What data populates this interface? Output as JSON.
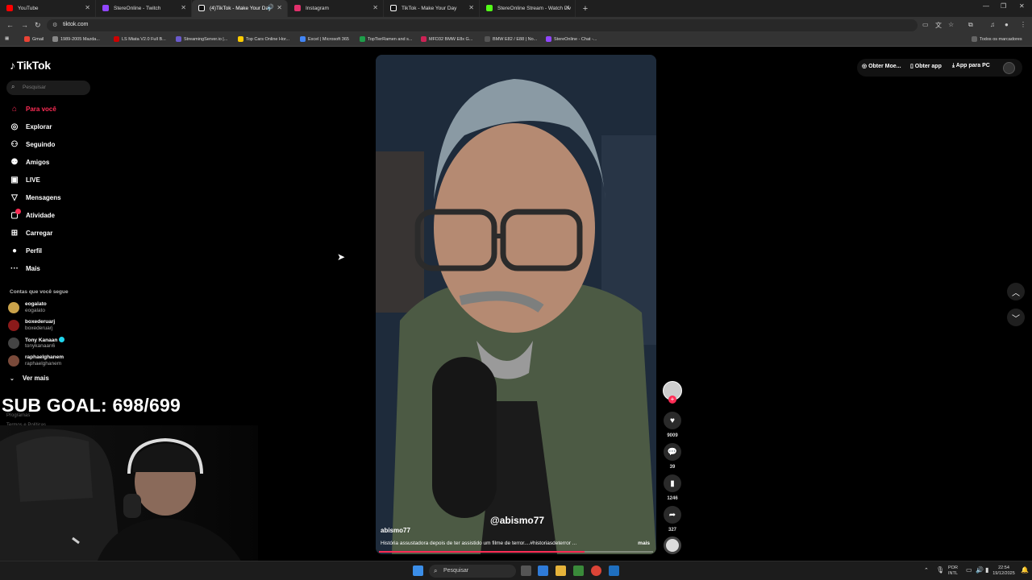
{
  "browser": {
    "tabs": [
      {
        "title": "YouTube",
        "color": "#ff0000",
        "active": false
      },
      {
        "title": "StereOnline - Twitch",
        "color": "#9146ff",
        "active": false
      },
      {
        "title": "(4)TikTok - Make Your Day",
        "color": "#333333",
        "active": true,
        "audio": true
      },
      {
        "title": "Instagram",
        "color": "#e1306c",
        "active": false
      },
      {
        "title": "TikTok - Make Your Day",
        "color": "#333333",
        "active": false
      },
      {
        "title": "StereOnline Stream - Watch Liv",
        "color": "#53fc18",
        "active": false
      }
    ],
    "url": "tiktok.com",
    "bookmarks": [
      {
        "label": "Gmail",
        "color": "#ea4335"
      },
      {
        "label": "1989-2005 Mazda...",
        "color": "#888888"
      },
      {
        "label": "LS Miata V2.0 Full B...",
        "color": "#cc0000"
      },
      {
        "label": "StreamingServer.io |...",
        "color": "#6a5acd"
      },
      {
        "label": "Top Cars Online Hor...",
        "color": "#ffcc00"
      },
      {
        "label": "Excel | Microsoft 365",
        "color": "#4285f4"
      },
      {
        "label": "TopTierRamen and s...",
        "color": "#1e9e4a"
      },
      {
        "label": "MFD32 BMW E8x G...",
        "color": "#cc2255"
      },
      {
        "label": "BMW E82 / E88 | No...",
        "color": "#555555"
      },
      {
        "label": "StereOnline - Chat -...",
        "color": "#9146ff"
      }
    ],
    "all_bookmarks": "Todos os marcadores"
  },
  "tiktok": {
    "logo": "TikTok",
    "search_placeholder": "Pesquisar",
    "nav": [
      {
        "label": "Para você",
        "icon": "home-icon",
        "active": true
      },
      {
        "label": "Explorar",
        "icon": "compass-icon",
        "active": false
      },
      {
        "label": "Seguindo",
        "icon": "person-follow-icon",
        "active": false
      },
      {
        "label": "Amigos",
        "icon": "friends-icon",
        "active": false
      },
      {
        "label": "LIVE",
        "icon": "live-icon",
        "active": false
      },
      {
        "label": "Mensagens",
        "icon": "messages-icon",
        "active": false
      },
      {
        "label": "Atividade",
        "icon": "activity-icon",
        "active": false
      },
      {
        "label": "Carregar",
        "icon": "upload-icon",
        "active": false
      },
      {
        "label": "Perfil",
        "icon": "profile-icon",
        "active": false
      },
      {
        "label": "Mais",
        "icon": "more-icon",
        "active": false
      }
    ],
    "following_title": "Contas que você segue",
    "accounts": [
      {
        "name": "eogalato",
        "handle": "eogalato",
        "color": "#c9a24a",
        "verified": false
      },
      {
        "name": "boxederuarj",
        "handle": "boxederuarj",
        "color": "#8b1a1a",
        "verified": false
      },
      {
        "name": "Tony Kanaan",
        "handle": "tonykanaan6",
        "color": "#444444",
        "verified": true
      },
      {
        "name": "raphaelghanem",
        "handle": "raphaelghanem",
        "color": "#7a4a3a",
        "verified": false
      }
    ],
    "see_more": "Ver mais",
    "footer": [
      "Programas",
      "Termos e Políticas"
    ],
    "top_right": {
      "get_coins": "Obter Moe...",
      "get_app": "Obter app",
      "pc_app": "App para PC"
    },
    "video": {
      "author": "abismo77",
      "watermark": "@abismo77",
      "caption": "História assustadora depois de ter assistido um filme de terror....#historiasdeterror ...",
      "more": "mais",
      "progress": 0.75
    },
    "actions": {
      "likes": "9009",
      "comments": "39",
      "saves": "1246",
      "shares": "327"
    }
  },
  "overlay": {
    "sub_goal": "SUB GOAL: 698/699"
  },
  "taskbar": {
    "search_label": "Pesquisar",
    "lang_top": "POR",
    "lang_bottom": "INTL",
    "time": "22:54",
    "date": "19/12/2025"
  }
}
